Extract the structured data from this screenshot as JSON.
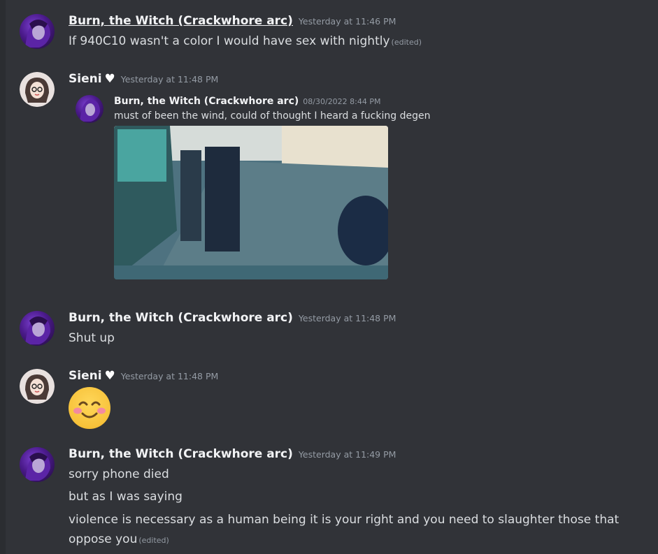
{
  "messages": [
    {
      "author": "Burn, the Witch (Crackwhore arc)",
      "time": "Yesterday at 11:46 PM",
      "lines": [
        "If 940C10 wasn't a color I would have sex with nightly"
      ],
      "edited": "(edited)"
    },
    {
      "author": "Sieni",
      "time": "Yesterday at 11:48 PM",
      "forward": {
        "author": "Burn, the Witch (Crackwhore arc)",
        "time": "08/30/2022 8:44 PM",
        "text": "must of been the wind, could of thought I heard a fucking degen"
      }
    },
    {
      "author": "Burn, the Witch (Crackwhore arc)",
      "time": "Yesterday at 11:48 PM",
      "lines": [
        "Shut up"
      ]
    },
    {
      "author": "Sieni",
      "time": "Yesterday at 11:48 PM",
      "emoji": "smiling-face-with-smiling-eyes"
    },
    {
      "author": "Burn, the Witch (Crackwhore arc)",
      "time": "Yesterday at 11:49 PM",
      "lines": [
        "sorry phone died",
        "but as I was saying",
        "violence is necessary as a human being it is your right and you need to slaughter those that",
        "oppose you"
      ],
      "edited": "(edited)"
    }
  ],
  "colors": {
    "background": "#313338",
    "username": "#f2f3f5",
    "text": "#dbdee1",
    "muted": "#949ba4"
  }
}
